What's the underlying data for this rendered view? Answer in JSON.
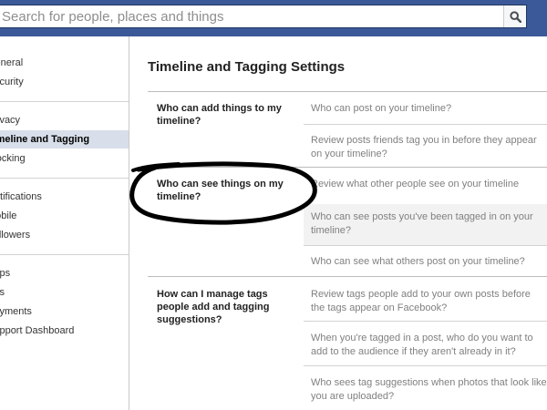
{
  "search": {
    "placeholder": "Search for people, places and things",
    "icon": "search-icon"
  },
  "sidebar": {
    "groups": [
      [
        "General",
        "Security"
      ],
      [
        "Privacy",
        "Timeline and Tagging",
        "Blocking"
      ],
      [
        "Notifications",
        "Mobile",
        "Followers"
      ],
      [
        "Apps",
        "Ads",
        "Payments",
        "Support Dashboard"
      ]
    ],
    "active": "Timeline and Tagging"
  },
  "main": {
    "title": "Timeline and Tagging Settings",
    "sections": [
      {
        "label": "Who can add things to my timeline?",
        "options": [
          "Who can post on your timeline?",
          "Review posts friends tag you in before they appear on your timeline?"
        ]
      },
      {
        "label": "Who can see things on my timeline?",
        "options": [
          "Review what other people see on your timeline",
          "Who can see posts you've been tagged in on your timeline?",
          "Who can see what others post on your timeline?"
        ]
      },
      {
        "label": "How can I manage tags people add and tagging suggestions?",
        "options": [
          "Review tags people add to your own posts before the tags appear on Facebook?",
          "When you're tagged in a post, who do you want to add to the audience if they aren't already in it?",
          "Who sees tag suggestions when photos that look like you are uploaded?"
        ]
      }
    ]
  }
}
